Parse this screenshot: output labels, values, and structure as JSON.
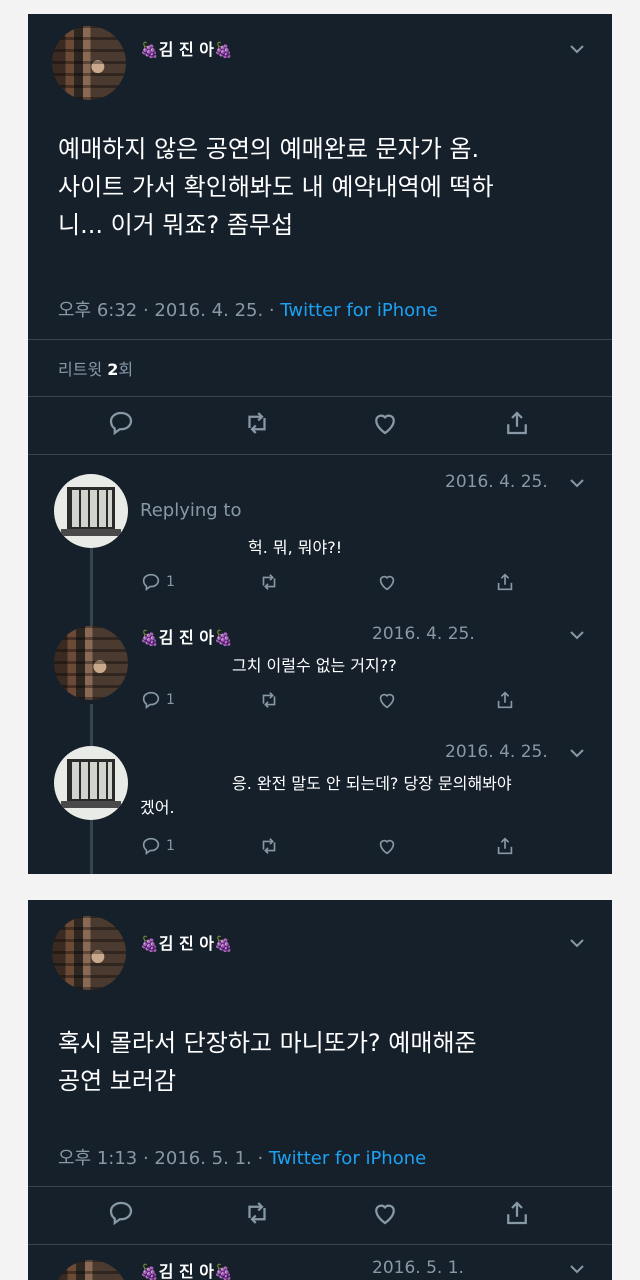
{
  "tweet1": {
    "author": "김 진 아",
    "emoji": "🍇",
    "text": "예매하지 않은 공연의 예매완료 문자가 옴.\n사이트 가서 확인해봐도 내 예약내역에 떡하\n니... 이거 뭐죠? 좀무섭",
    "time": "오후 6:32 · 2016. 4. 25. · ",
    "source": "Twitter for iPhone",
    "retweets_label": "리트윗 ",
    "retweets_count": "2",
    "retweets_suffix": "회"
  },
  "replies": [
    {
      "author": "",
      "date": "2016. 4. 25.",
      "replying": "Replying to",
      "text": "헉. 뭐, 뭐야?!",
      "reply_count": "1"
    },
    {
      "author": "김 진 아",
      "date": "2016. 4. 25.",
      "text": "그치 이럴수 없는 거지??",
      "reply_count": "1"
    },
    {
      "author": "",
      "date": "2016. 4. 25.",
      "text": "응. 완전 말도 안 되는데? 당장 문의해봐야\n겠어.",
      "reply_count": "1"
    }
  ],
  "tweet2": {
    "author": "김 진 아",
    "emoji": "🍇",
    "text": "혹시 몰라서 단장하고 마니또가? 예매해준\n공연 보러감",
    "time": "오후 1:13 · 2016. 5. 1. · ",
    "source": "Twitter for iPhone"
  },
  "partial_reply": {
    "author": "김 진 아",
    "date": "2016. 5. 1."
  },
  "colors": {
    "background": "#15202b",
    "muted": "#8899a6",
    "accent": "#1da1f2",
    "divider": "#38444d"
  }
}
